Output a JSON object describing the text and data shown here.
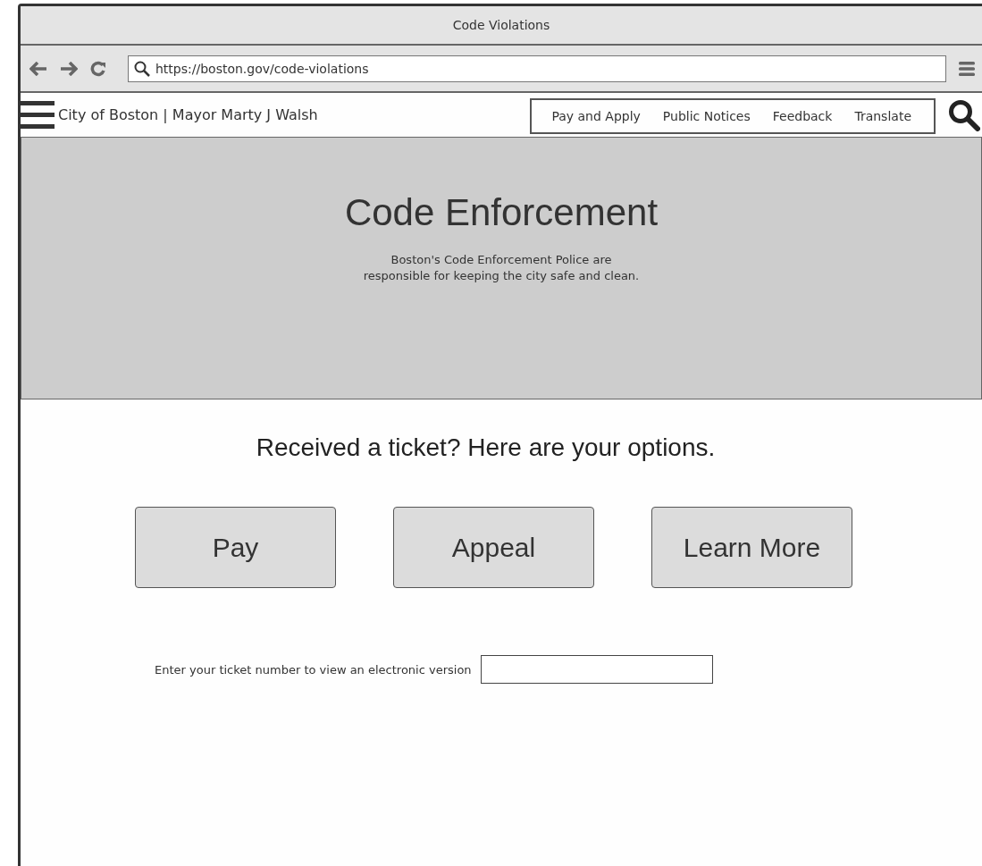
{
  "window": {
    "title": "Code Violations"
  },
  "browser": {
    "url": "https://boston.gov/code-violations"
  },
  "site_header": {
    "title": "City of Boston | Mayor Marty J Walsh",
    "nav": [
      "Pay and Apply",
      "Public Notices",
      "Feedback",
      "Translate"
    ]
  },
  "hero": {
    "title": "Code Enforcement",
    "subtitle": [
      "Boston's Code Enforcement Police are",
      "responsible for keeping the city safe and clean."
    ]
  },
  "options": {
    "heading": "Received a ticket? Here are your options.",
    "buttons": [
      "Pay",
      "Appeal",
      "Learn More"
    ]
  },
  "ticket_lookup": {
    "label": "Enter your ticket number to view an electronic version"
  }
}
